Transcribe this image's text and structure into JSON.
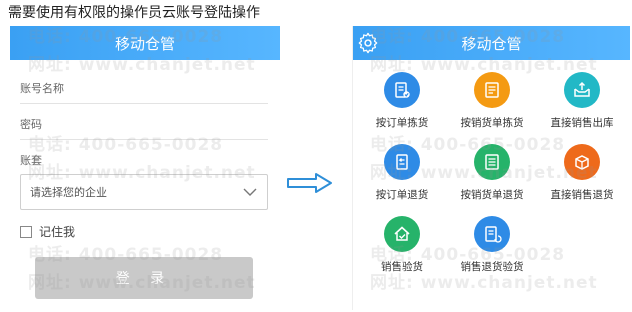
{
  "caption": "需要使用有权限的操作员云账号登陆操作",
  "watermark": {
    "phone": "电话: 400-665-0028",
    "site": "网址: www.chanjet.net"
  },
  "login": {
    "title": "移动仓管",
    "account_label": "账号名称",
    "password_label": "密码",
    "ledger_label": "账套",
    "ledger_placeholder": "请选择您的企业",
    "remember_label": "记住我",
    "login_button": "登 录"
  },
  "home": {
    "title": "移动仓管",
    "tiles": [
      {
        "label": "按订单拣货",
        "color": "#2e8be6",
        "icon": "clipboard-check-icon"
      },
      {
        "label": "按销货单拣货",
        "color": "#f49a12",
        "icon": "document-list-icon"
      },
      {
        "label": "直接销售出库",
        "color": "#22b8c6",
        "icon": "box-out-icon"
      },
      {
        "label": "按订单退货",
        "color": "#2e8be6",
        "icon": "return-order-icon"
      },
      {
        "label": "按销货单退货",
        "color": "#26b36a",
        "icon": "return-document-icon"
      },
      {
        "label": "直接销售退货",
        "color": "#ee6a1b",
        "icon": "package-return-icon"
      },
      {
        "label": "销售验货",
        "color": "#26b36a",
        "icon": "house-check-icon"
      },
      {
        "label": "销售退货验货",
        "color": "#2e8be6",
        "icon": "return-check-icon"
      }
    ]
  },
  "colors": {
    "titlebar": "#3aa0f3",
    "button_disabled": "#c9c9c9",
    "arrow": "#2f8fd8"
  }
}
